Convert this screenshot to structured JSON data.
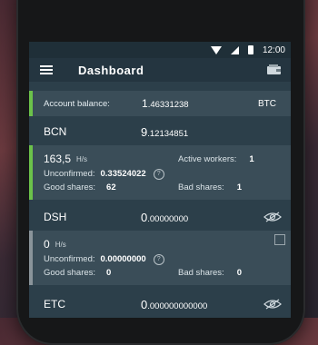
{
  "status": {
    "time": "12:00"
  },
  "appbar": {
    "title": "Dashboard"
  },
  "account": {
    "label": "Account balance:",
    "value_main": "1",
    "value_frac": ".46331238",
    "unit": "BTC"
  },
  "coins": [
    {
      "name": "BCN",
      "value_main": "9",
      "value_frac": ".12134851",
      "hashrate": "163,5",
      "hash_unit": "H/s",
      "active_workers_label": "Active workers:",
      "active_workers": "1",
      "unconfirmed_label": "Unconfirmed:",
      "unconfirmed": "0.33524022",
      "good_label": "Good shares:",
      "good": "62",
      "bad_label": "Bad shares:",
      "bad": "1"
    },
    {
      "name": "DSH",
      "value_main": "0",
      "value_frac": ".00000000",
      "hashrate": "0",
      "hash_unit": "H/s",
      "unconfirmed_label": "Unconfirmed:",
      "unconfirmed": "0.00000000",
      "good_label": "Good shares:",
      "good": "0",
      "bad_label": "Bad shares:",
      "bad": "0"
    },
    {
      "name": "ETC",
      "value_main": "0",
      "value_frac": ".000000000000"
    }
  ],
  "icons": {
    "menu": "menu-icon",
    "wallet": "wallet-icon",
    "eye": "eye-hidden-icon",
    "help": "help-icon"
  },
  "colors": {
    "accent_green": "#6bc24a",
    "accent_grey": "#8a949a",
    "card": "#3a4d58",
    "background": "#2c3f4a"
  }
}
